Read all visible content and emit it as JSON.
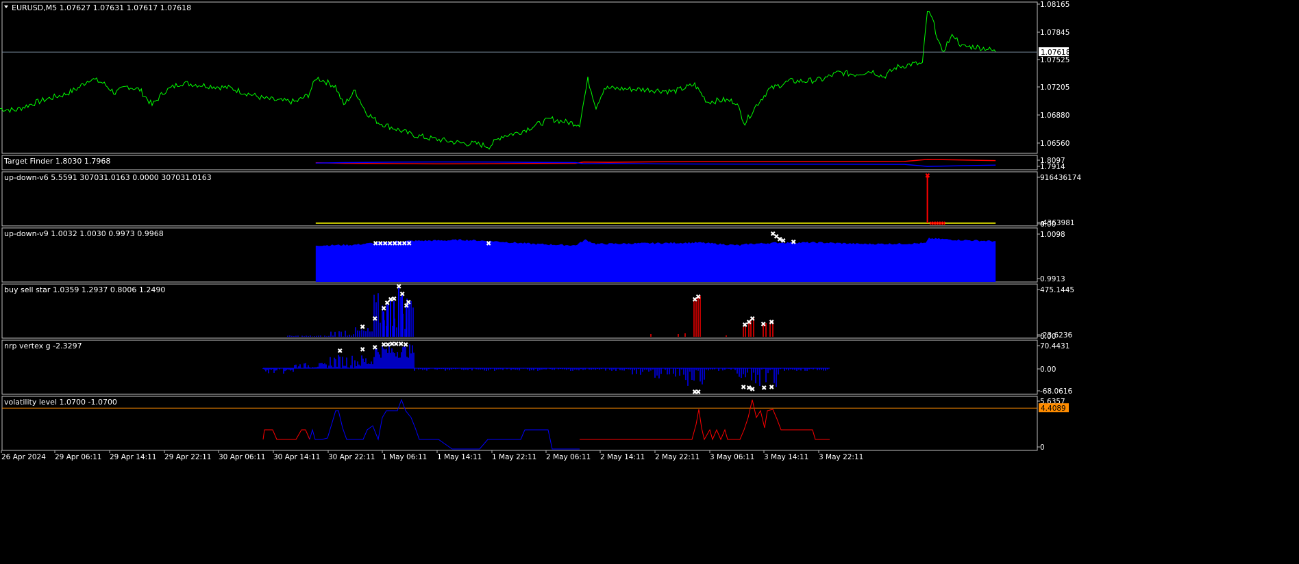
{
  "colors": {
    "background": "#000000",
    "frame": "#c0c0c0",
    "text": "#ffffff",
    "price": "#00ff00",
    "red": "#ff0000",
    "blue": "#0000ff",
    "yellow": "#ffff00",
    "orange": "#ff8c00",
    "white_marks": "#ffffff",
    "price_line": "#778899"
  },
  "chart_data": [
    {
      "type": "line",
      "title": "EURUSD,M5  1.07627 1.07631 1.07617 1.07618",
      "title_icon": "triangle-down-icon",
      "y_ticks": [
        "1.08165",
        "1.07845",
        "1.07525",
        "1.07205",
        "1.06880",
        "1.06560"
      ],
      "ylim": [
        1.0644,
        1.082
      ],
      "current_price": "1.07618",
      "current_value": 1.07618,
      "series": [
        {
          "points": [
            [
              0,
              1.0696
            ],
            [
              18,
              1.0694
            ],
            [
              40,
              1.0702
            ],
            [
              60,
              1.0708
            ],
            [
              80,
              1.0713
            ],
            [
              95,
              1.072
            ],
            [
              110,
              1.0731
            ],
            [
              125,
              1.0726
            ],
            [
              140,
              1.0714
            ],
            [
              155,
              1.0722
            ],
            [
              170,
              1.0718
            ],
            [
              185,
              1.07
            ],
            [
              200,
              1.0716
            ],
            [
              220,
              1.0726
            ],
            [
              240,
              1.0724
            ],
            [
              260,
              1.0722
            ],
            [
              280,
              1.072
            ],
            [
              300,
              1.0714
            ],
            [
              320,
              1.0708
            ],
            [
              340,
              1.0705
            ],
            [
              360,
              1.0704
            ],
            [
              375,
              1.0712
            ],
            [
              385,
              1.0732
            ],
            [
              395,
              1.0728
            ],
            [
              408,
              1.0722
            ],
            [
              418,
              1.07
            ],
            [
              432,
              1.0717
            ],
            [
              445,
              1.0692
            ],
            [
              460,
              1.068
            ],
            [
              480,
              1.0673
            ],
            [
              500,
              1.0666
            ],
            [
              520,
              1.0662
            ],
            [
              540,
              1.0659
            ],
            [
              560,
              1.0656
            ],
            [
              580,
              1.0655
            ],
            [
              595,
              1.0652
            ],
            [
              610,
              1.0664
            ],
            [
              630,
              1.0668
            ],
            [
              650,
              1.0676
            ],
            [
              670,
              1.0684
            ],
            [
              690,
              1.068
            ],
            [
              705,
              1.0678
            ],
            [
              715,
              1.073
            ],
            [
              725,
              1.0698
            ],
            [
              735,
              1.072
            ],
            [
              760,
              1.0719
            ],
            [
              790,
              1.0718
            ],
            [
              820,
              1.0716
            ],
            [
              845,
              1.0724
            ],
            [
              860,
              1.0704
            ],
            [
              880,
              1.0706
            ],
            [
              895,
              1.0704
            ],
            [
              906,
              1.0679
            ],
            [
              920,
              1.07
            ],
            [
              935,
              1.0718
            ],
            [
              960,
              1.0728
            ],
            [
              980,
              1.0728
            ],
            [
              1000,
              1.073
            ],
            [
              1020,
              1.0738
            ],
            [
              1040,
              1.0736
            ],
            [
              1060,
              1.074
            ],
            [
              1075,
              1.0733
            ],
            [
              1090,
              1.0744
            ],
            [
              1110,
              1.0748
            ],
            [
              1122,
              1.0748
            ],
            [
              1128,
              1.081
            ],
            [
              1134,
              1.08
            ],
            [
              1140,
              1.078
            ],
            [
              1146,
              1.076
            ],
            [
              1152,
              1.0772
            ],
            [
              1160,
              1.0782
            ],
            [
              1170,
              1.0768
            ],
            [
              1185,
              1.0768
            ],
            [
              1200,
              1.0766
            ],
            [
              1211,
              1.0762
            ]
          ]
        }
      ]
    },
    {
      "type": "line",
      "title": "Target Finder 1.8030 1.7968",
      "y_ticks": [
        "1.8097",
        "1.7914"
      ],
      "ylim": [
        1.788,
        1.813
      ],
      "series": [
        {
          "color": "red",
          "points": [
            [
              384,
              1.8002
            ],
            [
              420,
              1.7992
            ],
            [
              480,
              1.7986
            ],
            [
              540,
              1.7982
            ],
            [
              600,
              1.7985
            ],
            [
              650,
              1.799
            ],
            [
              700,
              1.7992
            ],
            [
              710,
              1.8015
            ],
            [
              740,
              1.801
            ],
            [
              800,
              1.8018
            ],
            [
              900,
              1.802
            ],
            [
              1000,
              1.8022
            ],
            [
              1100,
              1.8024
            ],
            [
              1128,
              1.806
            ],
            [
              1170,
              1.805
            ],
            [
              1211,
              1.804
            ]
          ]
        },
        {
          "color": "blue",
          "points": [
            [
              384,
              1.7995
            ],
            [
              420,
              1.8005
            ],
            [
              480,
              1.8012
            ],
            [
              540,
              1.8016
            ],
            [
              600,
              1.8013
            ],
            [
              650,
              1.8008
            ],
            [
              700,
              1.8005
            ],
            [
              710,
              1.7985
            ],
            [
              740,
              1.7988
            ],
            [
              800,
              1.7982
            ],
            [
              900,
              1.7978
            ],
            [
              1000,
              1.7976
            ],
            [
              1100,
              1.7974
            ],
            [
              1128,
              1.7938
            ],
            [
              1170,
              1.795
            ],
            [
              1211,
              1.796
            ]
          ]
        }
      ]
    },
    {
      "type": "line",
      "title": "up-down-v6 5.5591 307031.0163 0.0000 307031.0163",
      "y_ticks": [
        "916436174",
        "4",
        "-4363981",
        "0.00"
      ],
      "ylim": [
        0,
        916436174
      ],
      "series": [
        {
          "color": "yellow",
          "points": [
            [
              384,
              0
            ],
            [
              1211,
              0
            ]
          ]
        },
        {
          "color": "red",
          "points": [
            [
              1128,
              0
            ],
            [
              1128,
              916436174
            ]
          ]
        }
      ]
    },
    {
      "type": "area",
      "title": "up-down-v9 1.0032 1.0030 0.9973 0.9968",
      "y_ticks": [
        "1.0098",
        "0.9913"
      ],
      "ylim": [
        0.991,
        1.0102
      ],
      "series": [
        {
          "color": "blue",
          "points": [
            [
              384,
              1.004
            ],
            [
              430,
              1.0042
            ],
            [
              480,
              1.0055
            ],
            [
              545,
              1.0058
            ],
            [
              560,
              1.006
            ],
            [
              600,
              1.0055
            ],
            [
              650,
              1.0045
            ],
            [
              700,
              1.004
            ],
            [
              712,
              1.006
            ],
            [
              725,
              1.0045
            ],
            [
              800,
              1.0048
            ],
            [
              850,
              1.005
            ],
            [
              900,
              1.004
            ],
            [
              910,
              1.0045
            ],
            [
              950,
              1.005
            ],
            [
              1000,
              1.005
            ],
            [
              1050,
              1.0045
            ],
            [
              1100,
              1.0046
            ],
            [
              1126,
              1.0048
            ],
            [
              1130,
              1.0065
            ],
            [
              1160,
              1.006
            ],
            [
              1211,
              1.0055
            ]
          ]
        }
      ]
    },
    {
      "type": "bar",
      "title": "buy sell star 1.0359 1.2937 0.8006 1.2490",
      "y_ticks": [
        "475.1445",
        "-23.6236",
        "0.00"
      ],
      "ylim": [
        0,
        475.1445
      ]
    },
    {
      "type": "bar",
      "title": "nrp vertex g -2.3297",
      "y_ticks": [
        "70.4431",
        "0.00",
        "-68.0616"
      ],
      "ylim": [
        -68.0616,
        70.4431
      ]
    },
    {
      "type": "line",
      "title": "volatility level 1.0700 -1.0700",
      "y_ticks": [
        "5.6357",
        "0"
      ],
      "ylim": [
        0,
        5.6357
      ],
      "level": 4.4089,
      "level_label": "4.4089"
    }
  ],
  "time_axis": {
    "labels": [
      "26 Apr 2024",
      "29 Apr 06:11",
      "29 Apr 14:11",
      "29 Apr 22:11",
      "30 Apr 06:11",
      "30 Apr 14:11",
      "30 Apr 22:11",
      "1 May 06:11",
      "1 May 14:11",
      "1 May 22:11",
      "2 May 06:11",
      "2 May 14:11",
      "2 May 22:11",
      "3 May 06:11",
      "3 May 14:11",
      "3 May 22:11"
    ]
  }
}
